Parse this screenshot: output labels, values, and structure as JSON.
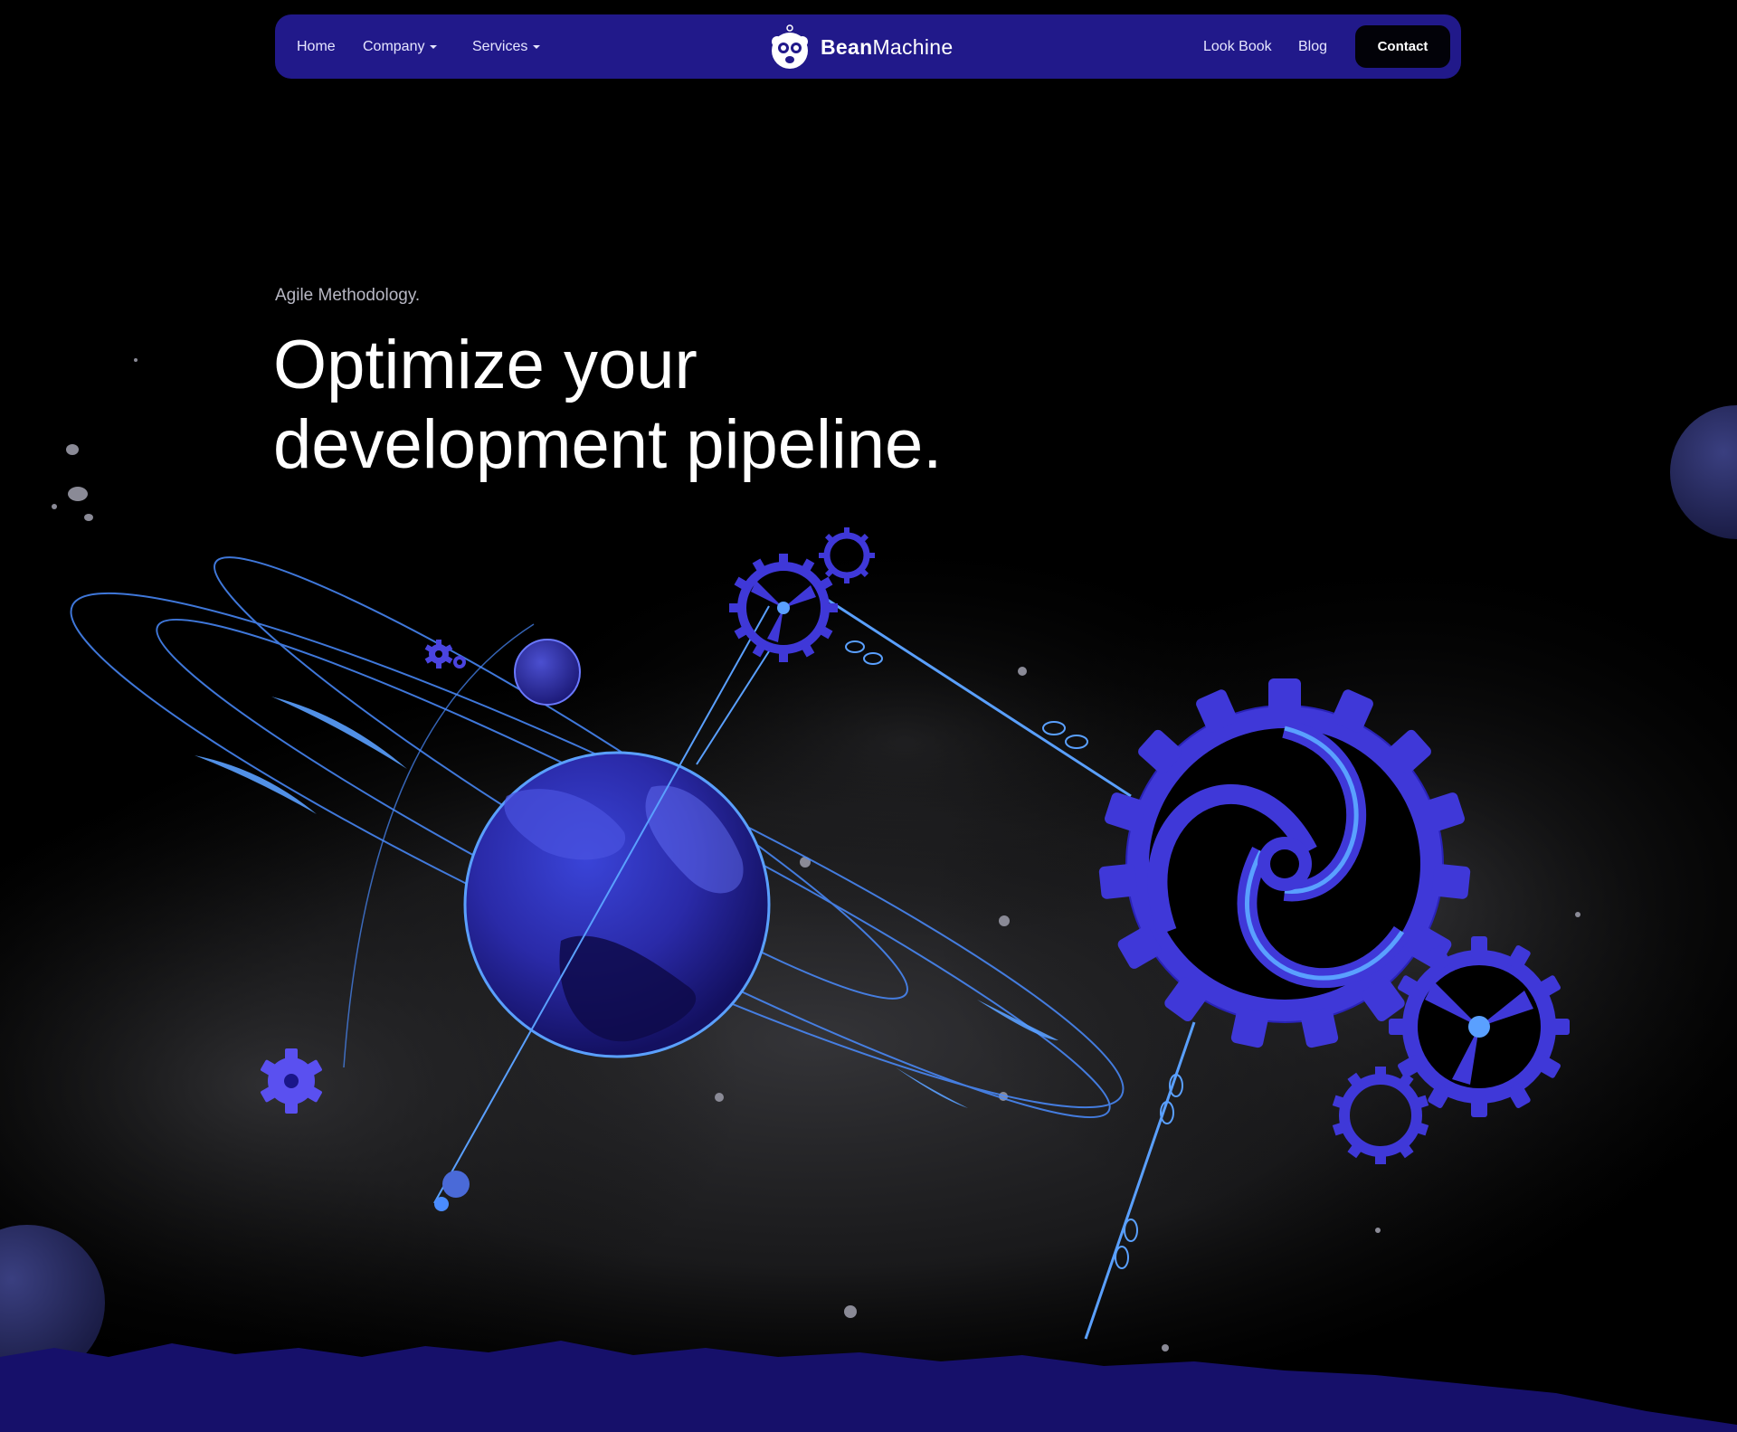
{
  "nav": {
    "home_label": "Home",
    "company_label": "Company",
    "services_label": "Services",
    "brand_bold": "Bean",
    "brand_light": "Machine",
    "lookbook_label": "Look Book",
    "blog_label": "Blog",
    "contact_label": "Contact"
  },
  "hero": {
    "eyebrow": "Agile Methodology.",
    "headline_line1": "Optimize your",
    "headline_line2": "development pipeline."
  },
  "colors": {
    "nav_bg": "#21198a",
    "accent_blue": "#3f38d8",
    "light_blue": "#5aa0ff",
    "ground": "#16106a",
    "background": "#000000"
  },
  "icons": {
    "brand_logo": "bean-mascot-icon",
    "dropdown": "chevron-down-icon"
  }
}
